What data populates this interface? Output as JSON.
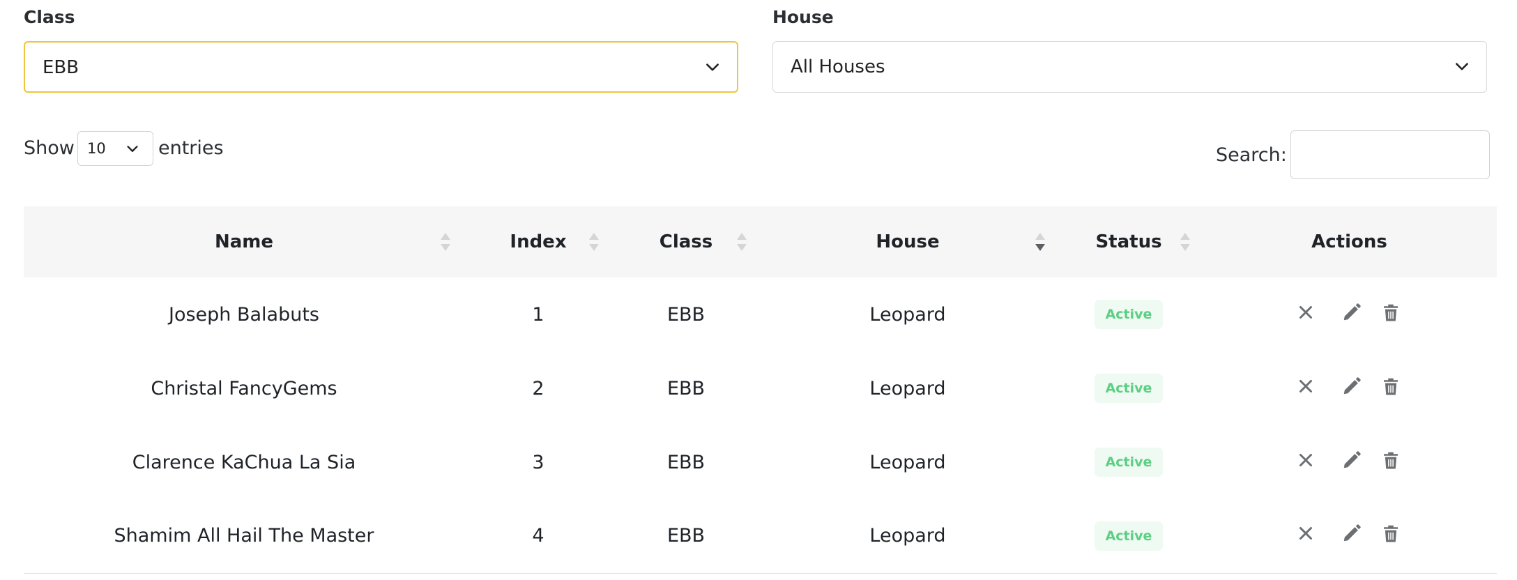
{
  "filters": {
    "class": {
      "label": "Class",
      "value": "EBB"
    },
    "house": {
      "label": "House",
      "value": "All Houses"
    }
  },
  "length_menu": {
    "prefix": "Show",
    "value": "10",
    "suffix": "entries"
  },
  "search": {
    "label": "Search:",
    "value": ""
  },
  "table": {
    "columns": [
      "Name",
      "Index",
      "Class",
      "House",
      "Status",
      "Actions"
    ],
    "sorted_column": "House",
    "sort_direction": "descending",
    "rows": [
      {
        "name": "Joseph Balabuts",
        "index": "1",
        "class": "EBB",
        "house": "Leopard",
        "status": "Active"
      },
      {
        "name": "Christal FancyGems",
        "index": "2",
        "class": "EBB",
        "house": "Leopard",
        "status": "Active"
      },
      {
        "name": "Clarence KaChua La Sia",
        "index": "3",
        "class": "EBB",
        "house": "Leopard",
        "status": "Active"
      },
      {
        "name": "Shamim All Hail The Master",
        "index": "4",
        "class": "EBB",
        "house": "Leopard",
        "status": "Active"
      }
    ],
    "row_actions": [
      "close-icon",
      "pencil-icon",
      "trash-icon"
    ]
  },
  "colors": {
    "focus_border": "#efc53e",
    "status_active_text": "#5ccf83",
    "status_active_bg": "#eefaf2",
    "header_bg": "#f6f6f6",
    "icon": "#6b6f73"
  }
}
